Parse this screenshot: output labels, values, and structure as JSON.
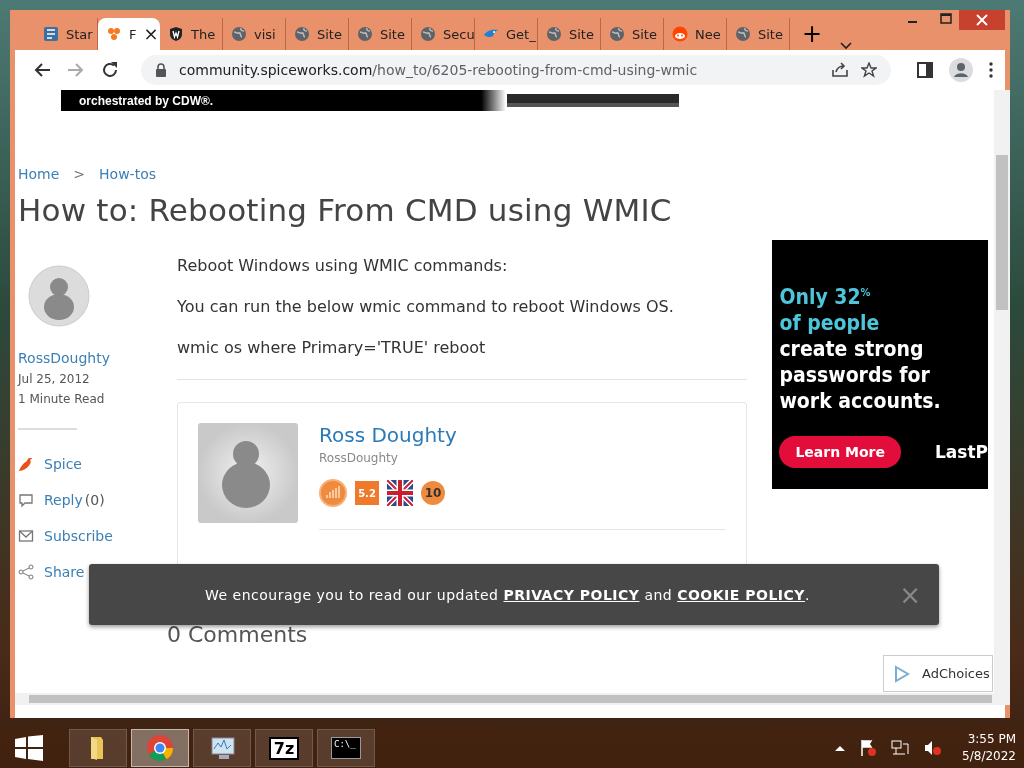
{
  "browser": {
    "tabs": [
      {
        "label": "Star",
        "kind": "doc",
        "selected": false
      },
      {
        "label": "F",
        "kind": "spice",
        "selected": true
      },
      {
        "label": "The",
        "kind": "shield",
        "selected": false
      },
      {
        "label": "visi",
        "kind": "globe",
        "selected": false
      },
      {
        "label": "Site",
        "kind": "globe",
        "selected": false
      },
      {
        "label": "Site",
        "kind": "globe",
        "selected": false
      },
      {
        "label": "Secu",
        "kind": "globe",
        "selected": false
      },
      {
        "label": "Get_",
        "kind": "bird",
        "selected": false
      },
      {
        "label": "Site",
        "kind": "globe",
        "selected": false
      },
      {
        "label": "Site",
        "kind": "globe",
        "selected": false
      },
      {
        "label": "Nee",
        "kind": "reddit",
        "selected": false
      },
      {
        "label": "Site",
        "kind": "globe",
        "selected": false
      }
    ],
    "tab_close": "×",
    "new_tab": "+",
    "url_host": "community.spiceworks.com",
    "url_path": "/how_to/6205-rebooting-from-cmd-using-wmic"
  },
  "top_ad": {
    "text": "orchestrated by CDW®."
  },
  "breadcrumbs": [
    {
      "label": "Home"
    },
    {
      "label": "How-tos"
    }
  ],
  "breadcrumb_separator": ">",
  "title": "How to: Rebooting From CMD using WMIC",
  "author": {
    "name": "RossDoughty",
    "date": "Jul 25, 2012",
    "read_time": "1 Minute Read"
  },
  "actions": [
    {
      "kind": "spice",
      "label": "Spice"
    },
    {
      "kind": "reply",
      "label": "Reply",
      "count": "(0)"
    },
    {
      "kind": "subscribe",
      "label": "Subscribe"
    },
    {
      "kind": "share",
      "label": "Share"
    }
  ],
  "body": [
    "Reboot Windows using WMIC commands:",
    "You can run the below wmic command to reboot Windows OS.",
    "wmic os where Primary='TRUE' reboot"
  ],
  "author_card": {
    "name": "Ross Doughty",
    "handle": "RossDoughty",
    "badges": [
      {
        "kind": "rank"
      },
      {
        "kind": "level",
        "text": "5.2"
      },
      {
        "kind": "flag"
      },
      {
        "kind": "years",
        "text": "10"
      }
    ]
  },
  "comments_heading": "0 Comments",
  "side_ad": {
    "highlight_lines": [
      "Only 32$^{%}$",
      "of people"
    ],
    "lines": [
      "create strong",
      "passwords for",
      "work accounts."
    ],
    "button": "Learn More",
    "brand": "LastP"
  },
  "cookie_banner": {
    "before": "We encourage you to read our updated",
    "link1": "PRIVACY POLICY",
    "between": "and",
    "link2": "COOKIE POLICY",
    "after": ".",
    "close": "×"
  },
  "ad_choices": "AdChoices",
  "taskbar": {
    "apps": [
      {
        "kind": "explorer",
        "selected": false
      },
      {
        "kind": "chrome",
        "selected": true
      },
      {
        "kind": "monitor",
        "selected": false
      },
      {
        "kind": "archiver",
        "label": "7z",
        "selected": false
      },
      {
        "kind": "console",
        "label": "C:\\_",
        "selected": false
      }
    ],
    "time": "3:55 PM",
    "date": "5/8/2022"
  }
}
